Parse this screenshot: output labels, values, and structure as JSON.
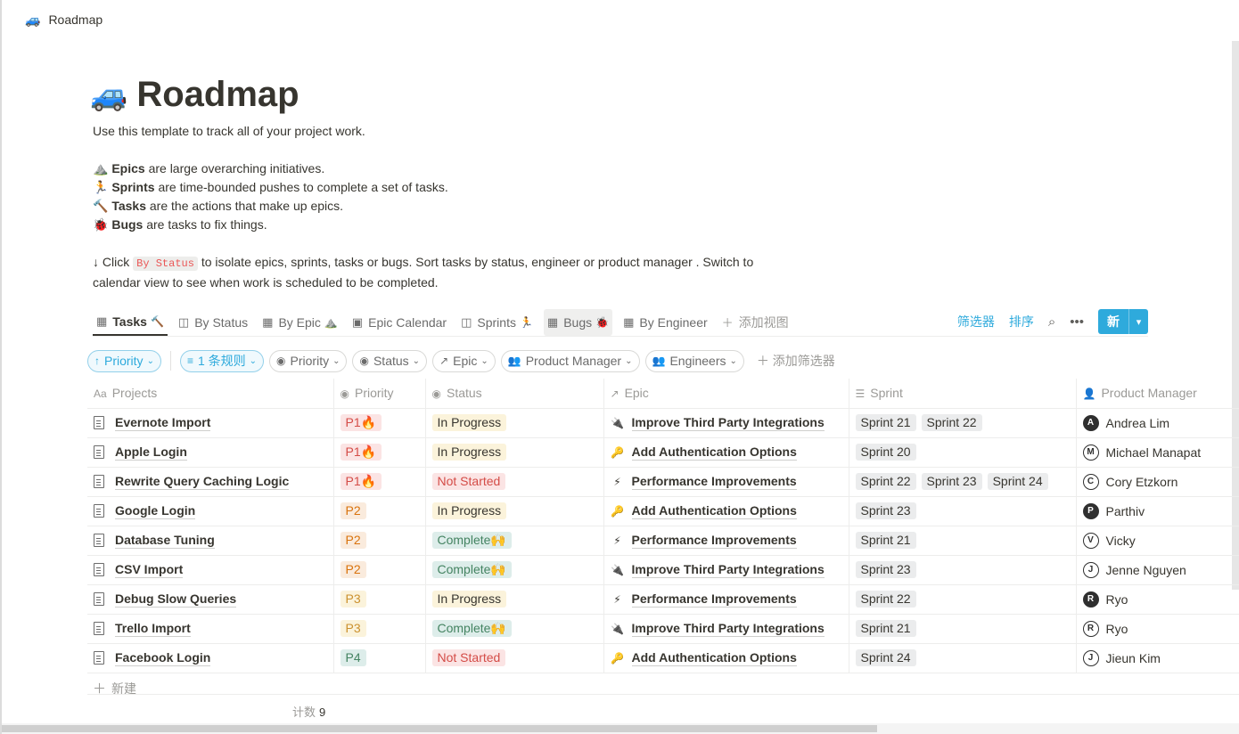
{
  "breadcrumb": {
    "icon": "🚙",
    "title": "Roadmap"
  },
  "page": {
    "icon": "🚙",
    "title": "Roadmap"
  },
  "description": {
    "intro": "Use this template to track all of your project work.",
    "items": [
      {
        "emoji": "⛰️",
        "term": "Epics",
        "text": " are large overarching initiatives."
      },
      {
        "emoji": "🏃",
        "term": "Sprints",
        "text": " are time-bounded pushes to complete a set of tasks."
      },
      {
        "emoji": "🔨",
        "term": "Tasks",
        "text": " are the actions that make up epics."
      },
      {
        "emoji": "🐞",
        "term": "Bugs",
        "text": " are tasks to fix things."
      }
    ],
    "click_prefix": "↓ Click ",
    "click_code": "By Status",
    "click_suffix_line1": " to isolate epics, sprints, tasks or bugs. Sort tasks by status, engineer or product manager . Switch to",
    "click_suffix_line2": "calendar view to see when work is scheduled to be completed."
  },
  "views": [
    {
      "icon": "table-icon",
      "label": "Tasks",
      "emoji": "🔨"
    },
    {
      "icon": "board-icon",
      "label": "By Status",
      "emoji": ""
    },
    {
      "icon": "table-icon",
      "label": "By Epic",
      "emoji": "⛰️"
    },
    {
      "icon": "calendar-icon",
      "label": "Epic Calendar",
      "emoji": ""
    },
    {
      "icon": "board-icon",
      "label": "Sprints",
      "emoji": "🏃"
    },
    {
      "icon": "table-icon",
      "label": "Bugs",
      "emoji": "🐞"
    },
    {
      "icon": "table-icon",
      "label": "By Engineer",
      "emoji": ""
    }
  ],
  "add_view_label": "添加视图",
  "toolbar": {
    "filter_label": "筛选器",
    "sort_label": "排序",
    "new_label": "新"
  },
  "filters": {
    "sort_pill": "Priority",
    "rule_pill": "1 条规则",
    "chips": [
      "Priority",
      "Status",
      "Epic",
      "Product Manager",
      "Engineers"
    ],
    "add_filter_label": "添加筛选器"
  },
  "columns": [
    "Projects",
    "Priority",
    "Status",
    "Epic",
    "Sprint",
    "Product Manager"
  ],
  "colors": {
    "accent": "#2eaadc",
    "p1_bg": "#fbe4e4",
    "p1_fg": "#d44c47",
    "p2_bg": "#faebdd",
    "p2_fg": "#d9730d",
    "p3_bg": "#fbf3db",
    "p3_fg": "#cb912f",
    "p4_bg": "#ddedea",
    "p4_fg": "#448361",
    "inprogress_bg": "#fbf3db",
    "notstarted_bg": "#fbe4e4",
    "notstarted_fg": "#d44c47",
    "complete_bg": "#ddedea",
    "complete_fg": "#448361",
    "sprint_bg": "#ebeced"
  },
  "rows": [
    {
      "project": "Evernote Import",
      "priority": "P1🔥",
      "status": "In Progress",
      "epic_icon": "🔌",
      "epic": "Improve Third Party Integrations",
      "sprints": [
        "Sprint 21",
        "Sprint 22"
      ],
      "pm": "Andrea Lim",
      "pm_avatar": "A"
    },
    {
      "project": "Apple Login",
      "priority": "P1🔥",
      "status": "In Progress",
      "epic_icon": "🔑",
      "epic": "Add Authentication Options",
      "sprints": [
        "Sprint 20"
      ],
      "pm": "Michael Manapat",
      "pm_avatar": "M"
    },
    {
      "project": "Rewrite Query Caching Logic",
      "priority": "P1🔥",
      "status": "Not Started",
      "epic_icon": "⚡",
      "epic": "Performance Improvements",
      "sprints": [
        "Sprint 22",
        "Sprint 23",
        "Sprint 24"
      ],
      "pm": "Cory Etzkorn",
      "pm_avatar": "C"
    },
    {
      "project": "Google Login",
      "priority": "P2",
      "status": "In Progress",
      "epic_icon": "🔑",
      "epic": "Add Authentication Options",
      "sprints": [
        "Sprint 23"
      ],
      "pm": "Parthiv",
      "pm_avatar": "P"
    },
    {
      "project": "Database Tuning",
      "priority": "P2",
      "status": "Complete🙌",
      "epic_icon": "⚡",
      "epic": "Performance Improvements",
      "sprints": [
        "Sprint 21"
      ],
      "pm": "Vicky",
      "pm_avatar": "V"
    },
    {
      "project": "CSV Import",
      "priority": "P2",
      "status": "Complete🙌",
      "epic_icon": "🔌",
      "epic": "Improve Third Party Integrations",
      "sprints": [
        "Sprint 23"
      ],
      "pm": "Jenne Nguyen",
      "pm_avatar": "J"
    },
    {
      "project": "Debug Slow Queries",
      "priority": "P3",
      "status": "In Progress",
      "epic_icon": "⚡",
      "epic": "Performance Improvements",
      "sprints": [
        "Sprint 22"
      ],
      "pm": "Ryo",
      "pm_avatar": "R"
    },
    {
      "project": "Trello Import",
      "priority": "P3",
      "status": "Complete🙌",
      "epic_icon": "🔌",
      "epic": "Improve Third Party Integrations",
      "sprints": [
        "Sprint 21"
      ],
      "pm": "Ryo",
      "pm_avatar": "R"
    },
    {
      "project": "Facebook Login",
      "priority": "P4",
      "status": "Not Started",
      "epic_icon": "🔑",
      "epic": "Add Authentication Options",
      "sprints": [
        "Sprint 24"
      ],
      "pm": "Jieun Kim",
      "pm_avatar": "J"
    }
  ],
  "new_row_label": "新建",
  "count": {
    "label": "计数",
    "value": "9"
  }
}
